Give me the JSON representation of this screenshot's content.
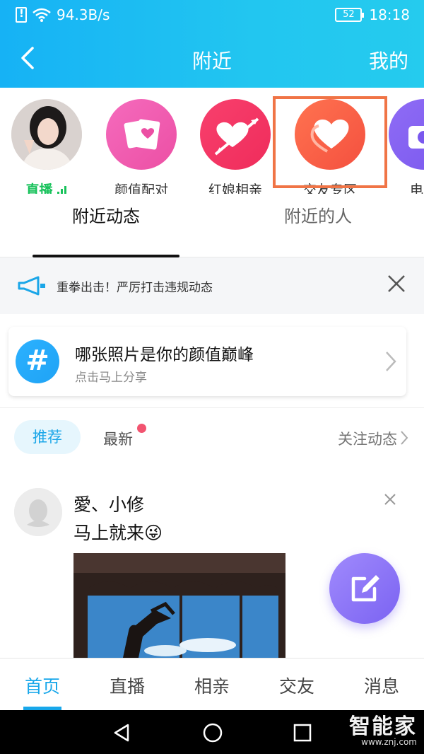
{
  "status_bar": {
    "speed": "94.3B/s",
    "battery": "52",
    "time": "18:18"
  },
  "nav": {
    "title": "附近",
    "right_action": "我的"
  },
  "shortcuts": [
    {
      "label": "直播",
      "icon": "live-avatar"
    },
    {
      "label": "颜值配对",
      "icon": "cards-heart-icon"
    },
    {
      "label": "红娘相亲",
      "icon": "cupid-heart-icon"
    },
    {
      "label": "交友专区",
      "icon": "hearts-icon"
    },
    {
      "label": "电",
      "icon": "camera-icon"
    }
  ],
  "tabs": [
    {
      "label": "附近动态"
    },
    {
      "label": "附近的人"
    }
  ],
  "notice": {
    "text": "重拳出击！严厉打击违规动态"
  },
  "topic_card": {
    "title": "哪张照片是你的颜值巅峰",
    "subtitle": "点击马上分享"
  },
  "filters": {
    "recommended": "推荐",
    "latest": "最新",
    "follow": "关注动态"
  },
  "post": {
    "username": "愛、小修",
    "content": "马上就来😜"
  },
  "bottom_nav": [
    {
      "label": "首页"
    },
    {
      "label": "直播"
    },
    {
      "label": "相亲"
    },
    {
      "label": "交友"
    },
    {
      "label": "消息"
    }
  ],
  "watermark": {
    "brand": "智能家",
    "url": "www.znj.com"
  },
  "colors": {
    "accent": "#18a7ea",
    "highlight_border": "#f07446",
    "live_green": "#18c25b"
  }
}
